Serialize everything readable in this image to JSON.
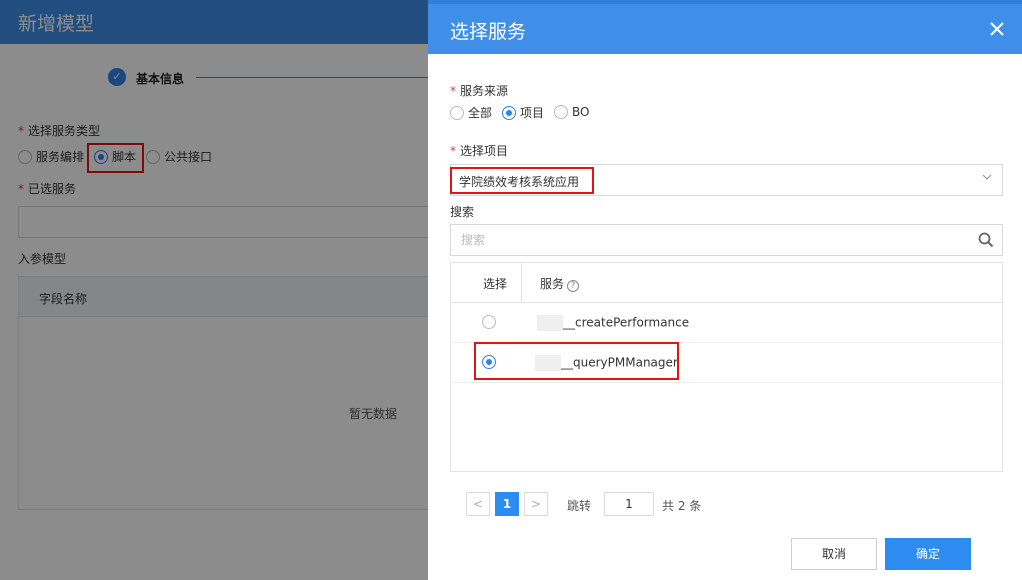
{
  "background": {
    "title": "新增模型",
    "step_label": "基本信息",
    "service_type_label": "选择服务类型",
    "service_type_options": [
      "服务编排",
      "脚本",
      "公共接口"
    ],
    "service_type_selected": "脚本",
    "selected_service_label": "已选服务",
    "param_model_label": "入参模型",
    "table_header": "字段名称",
    "empty_text": "暂无数据"
  },
  "drawer": {
    "title": "选择服务",
    "close_icon": "close-icon",
    "source_label": "服务来源",
    "source_options": [
      "全部",
      "项目",
      "BO"
    ],
    "source_selected": "项目",
    "project_label": "选择项目",
    "project_value": "学院绩效考核系统应用",
    "search_label": "搜索",
    "search_placeholder": "搜索",
    "table": {
      "col_select": "选择",
      "col_service": "服务",
      "rows": [
        {
          "name": "__createPerformance",
          "selected": false
        },
        {
          "name": "__queryPMManager",
          "selected": true
        }
      ]
    },
    "pagination": {
      "prev": "<",
      "current": "1",
      "next": ">",
      "jump_label": "跳转",
      "jump_value": "1",
      "total": "共 2 条"
    },
    "cancel_label": "取消",
    "confirm_label": "确定"
  },
  "colors": {
    "header_blue": "#3f8fe8",
    "primary": "#2d8cf0",
    "highlight_red": "#e41414"
  }
}
